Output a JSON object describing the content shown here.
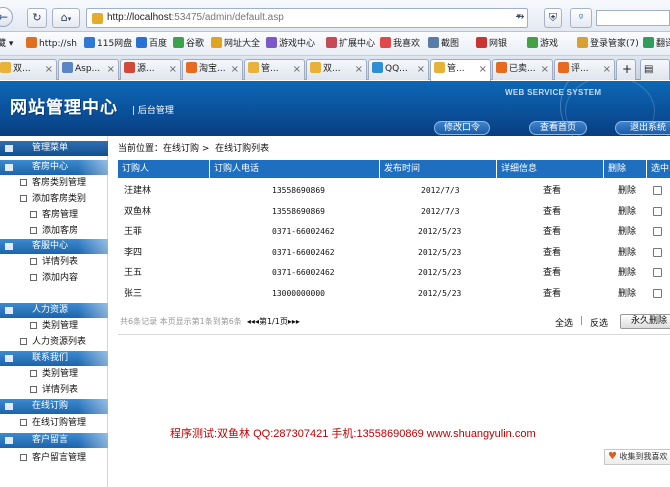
{
  "browser": {
    "back": "←",
    "forward": "→",
    "home": "⌂",
    "refresh": "↻",
    "url_host": "http://localhost",
    "url_rest": ":53475/admin/default.asp",
    "bookmarks": [
      {
        "label": "http://sh",
        "color": "#e0701e"
      },
      {
        "label": "115网盘",
        "color": "#2e78d6"
      },
      {
        "label": "百度",
        "color": "#2a6fd6"
      },
      {
        "label": "谷歌",
        "color": "#3aa34a"
      },
      {
        "label": "网址大全",
        "color": "#e0a41e"
      },
      {
        "label": "游戏中心",
        "color": "#7c58c8"
      },
      {
        "label": "扩展中心",
        "color": "#c84a58"
      },
      {
        "label": "我喜欢",
        "color": "#e2484a"
      },
      {
        "label": "截图",
        "color": "#5a7aa8"
      },
      {
        "label": "网银",
        "color": "#cc3333"
      },
      {
        "label": "游戏",
        "color": "#44a244"
      },
      {
        "label": "登录管家(7)",
        "color": "#d8a030"
      },
      {
        "label": "翻译",
        "color": "#2e9e5a"
      }
    ],
    "tabs": [
      {
        "label": "双...",
        "color": "#e8b13a"
      },
      {
        "label": "Asp...",
        "color": "#5b86c4"
      },
      {
        "label": "源...",
        "color": "#d04a3a"
      },
      {
        "label": "淘宝...",
        "color": "#e86a1e"
      },
      {
        "label": "管...",
        "color": "#e8b13a"
      },
      {
        "label": "双...",
        "color": "#e8b13a"
      },
      {
        "label": "QQ...",
        "color": "#2e8ed6"
      },
      {
        "label": "管...",
        "color": "#e8b13a"
      },
      {
        "label": "已卖...",
        "color": "#e86a1e"
      },
      {
        "label": "评...",
        "color": "#e86a1e"
      }
    ],
    "new_tab": "+"
  },
  "header": {
    "title": "网站管理中心",
    "subtitle": "后台管理",
    "service": "WEB SERVICE SYSTEM",
    "buttons": [
      "修改口令",
      "查看首页",
      "退出系统"
    ]
  },
  "sidebar": {
    "menu_label": "管理菜单",
    "groups": [
      {
        "title": "客房中心",
        "items": [
          "客房类别管理",
          "添加客房类别",
          "客房管理",
          "添加客房"
        ]
      },
      {
        "title": "客服中心",
        "items": [
          "详情列表",
          "添加内容"
        ]
      },
      {
        "title": "人力资源",
        "items": [
          "类别管理",
          "人力资源列表"
        ]
      },
      {
        "title": "联系我们",
        "items": [
          "类别管理",
          "详情列表"
        ]
      },
      {
        "title": "在线订购",
        "items": [
          "在线订购管理"
        ]
      },
      {
        "title": "客户留言",
        "items": [
          "客户留言管理"
        ]
      }
    ]
  },
  "breadcrumb": {
    "prefix": "当前位置：在线订购 >",
    "current": "在线订购列表"
  },
  "table": {
    "headers": [
      "订购人",
      "订购人电话",
      "发布时间",
      "详细信息",
      "删除",
      "选中"
    ],
    "rows": [
      {
        "name": "汪建林",
        "phone": "13558690869",
        "date": "2012/7/3",
        "view": "查看",
        "del": "删除"
      },
      {
        "name": "双鱼林",
        "phone": "13558690869",
        "date": "2012/7/3",
        "view": "查看",
        "del": "删除"
      },
      {
        "name": "王菲",
        "phone": "0371-66002462",
        "date": "2012/5/23",
        "view": "查看",
        "del": "删除"
      },
      {
        "name": "李四",
        "phone": "0371-66002462",
        "date": "2012/5/23",
        "view": "查看",
        "del": "删除"
      },
      {
        "name": "王五",
        "phone": "0371-66002462",
        "date": "2012/5/23",
        "view": "查看",
        "del": "删除"
      },
      {
        "name": "张三",
        "phone": "13000000000",
        "date": "2012/5/23",
        "view": "查看",
        "del": "删除"
      }
    ]
  },
  "pager": {
    "summary": "共6条记录  本页显示第1条到第6条",
    "nav": "◂◂◂第1/1页▸▸▸"
  },
  "actions": {
    "select_all": "全选",
    "separator": "|",
    "invert": "反选",
    "delete": "永久删除"
  },
  "footer": "程序测试:双鱼林 QQ:287307421 手机:13558690869 www.shuangyulin.com",
  "favorite": {
    "icon": "♥",
    "label": "收集到我喜欢"
  }
}
